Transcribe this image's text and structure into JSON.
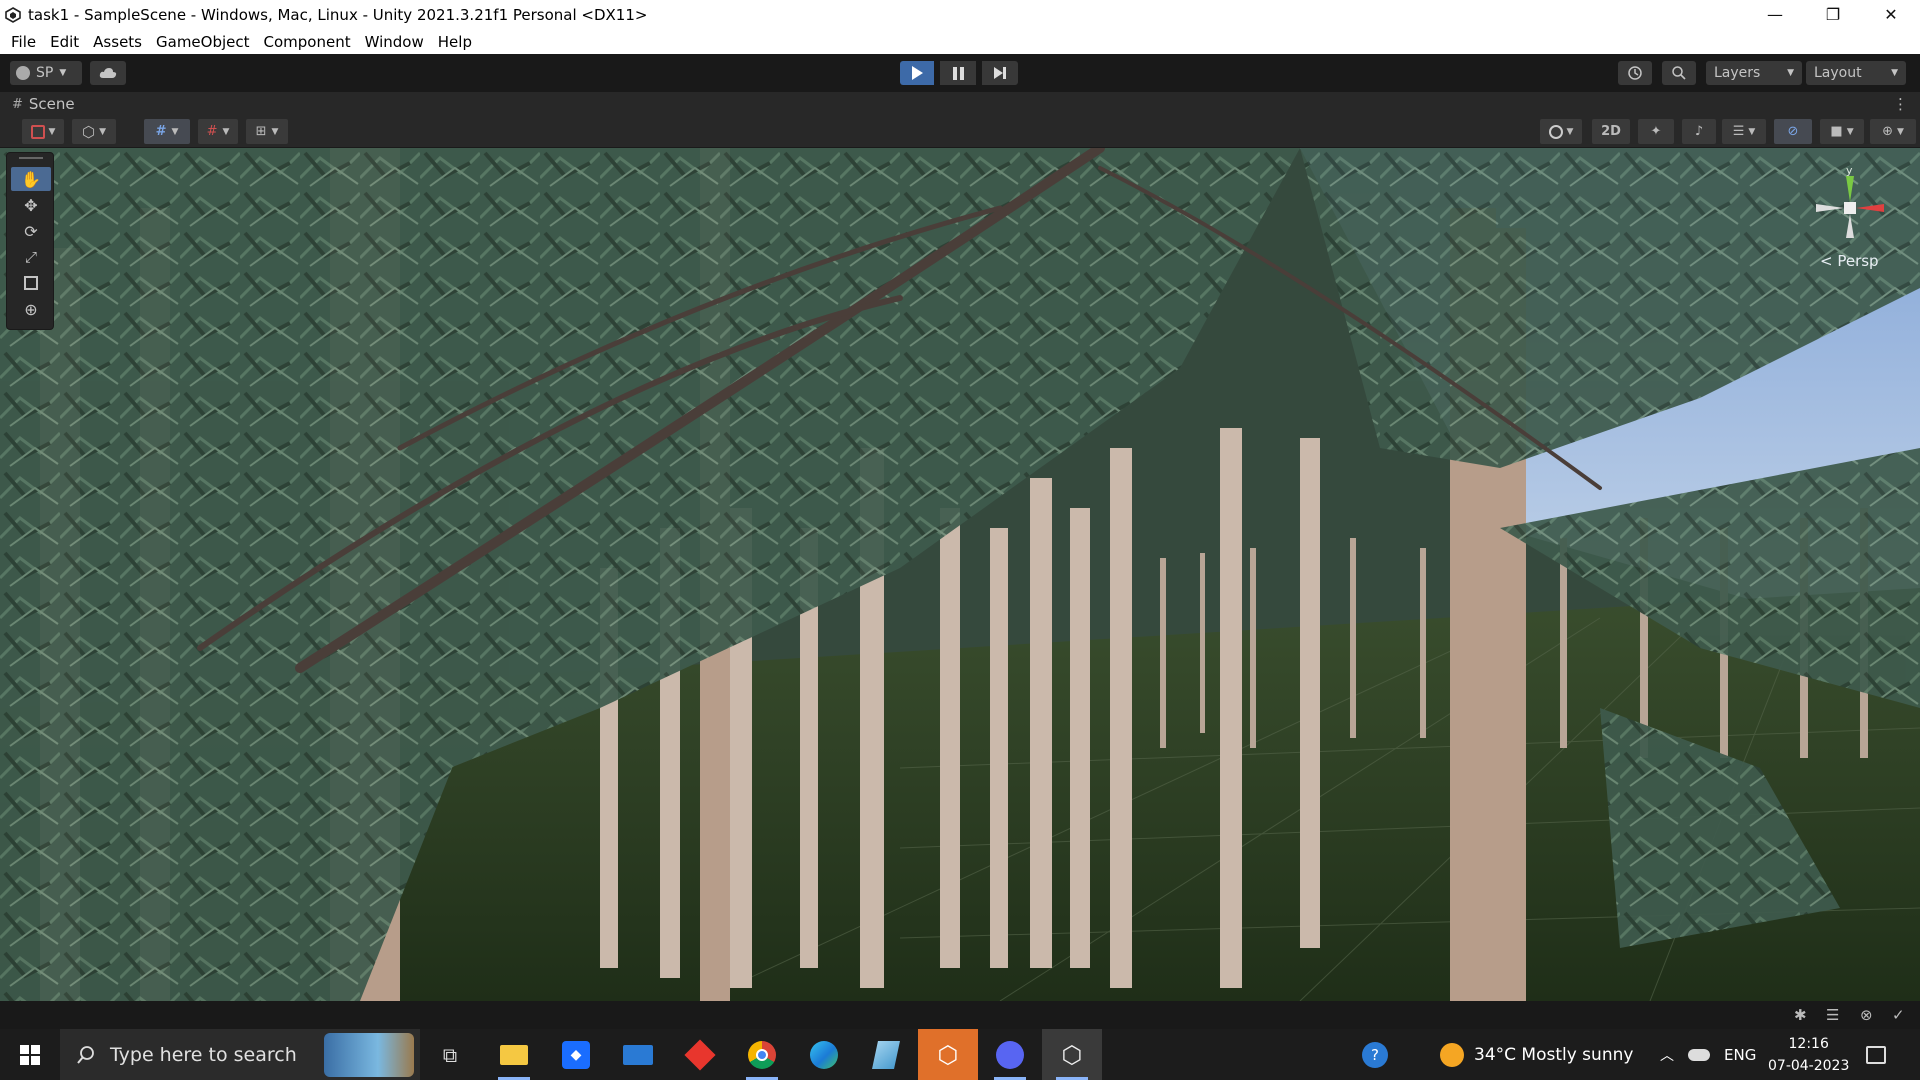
{
  "window": {
    "title": "task1 - SampleScene - Windows, Mac, Linux - Unity 2021.3.21f1 Personal <DX11>",
    "minimize": "—",
    "restore": "❐",
    "close": "✕"
  },
  "menu": [
    "File",
    "Edit",
    "Assets",
    "GameObject",
    "Component",
    "Window",
    "Help"
  ],
  "toolbar": {
    "account_label": "SP",
    "layers_label": "Layers",
    "layout_label": "Layout"
  },
  "scene": {
    "tab_label": "Scene",
    "btn_2d": "2D",
    "persp_label": "< Persp",
    "gizmo_y": "y"
  },
  "taskbar": {
    "search_placeholder": "Type here to search",
    "weather": "34°C  Mostly sunny",
    "lang": "ENG",
    "time": "12:16",
    "date": "07-04-2023"
  },
  "colors": {
    "editor_dark": "#191919",
    "panel": "#282828",
    "foliage": "#3f5a4a",
    "ground": "#2e4325",
    "sky": "#9cb8dc",
    "trunk": "#c9b7a9",
    "accent_blue": "#4b7cc8"
  }
}
